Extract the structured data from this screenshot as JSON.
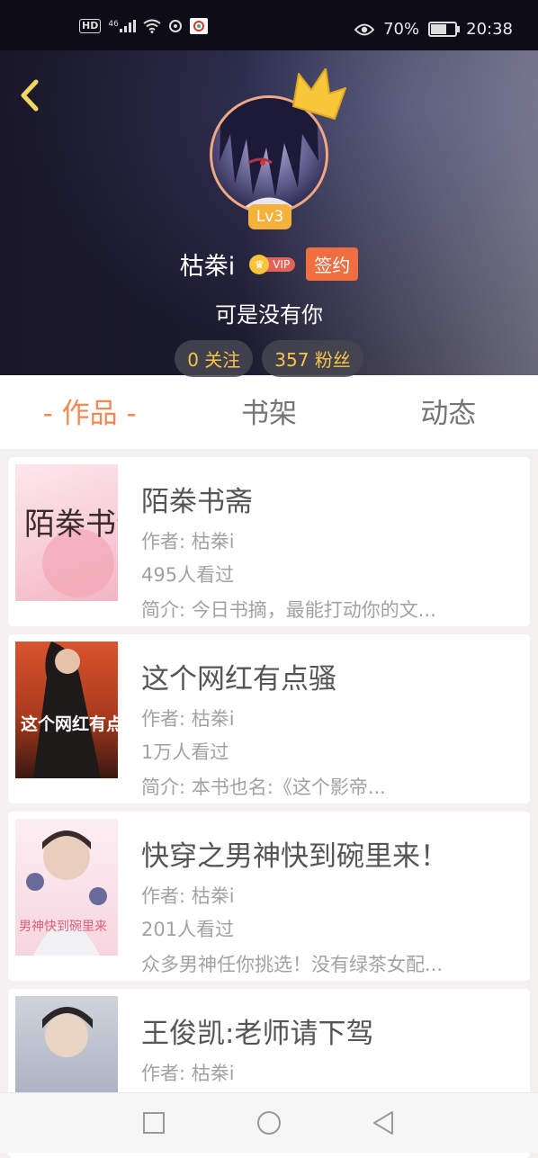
{
  "status_bar": {
    "hd": "HD",
    "network": "46",
    "battery_percent": "70%",
    "battery_level": 0.7,
    "time": "20:38"
  },
  "profile": {
    "level": "Lv3",
    "name": "枯桊i",
    "vip": "VIP",
    "signed": "签约",
    "bio": "可是没有你",
    "following": "0 关注",
    "followers": "357 粉丝"
  },
  "tabs": [
    "- 作品 -",
    "书架",
    "动态"
  ],
  "books": [
    {
      "title": "陌桊书斋",
      "author": "作者: 枯桊i",
      "views": "495人看过",
      "intro": "简介: 今日书摘，最能打动你的文...",
      "cover_text": "陌桊书斋"
    },
    {
      "title": "这个网红有点骚",
      "author": "作者: 枯桊i",
      "views": "1万人看过",
      "intro": "简介: 本书也名:《这个影帝...",
      "cover_text": "这个网红有点骚"
    },
    {
      "title": "快穿之男神快到碗里来！",
      "author": "作者: 枯桊i",
      "views": "201人看过",
      "intro": "众多男神任你挑选！没有绿茶女配...",
      "cover_text": "男神快到碗里来"
    },
    {
      "title": "王俊凯:老师请下驾",
      "author": "作者: 枯桊i",
      "views": "",
      "intro": "",
      "cover_text": ""
    }
  ],
  "colors": {
    "accent": "#ef8a55",
    "level_badge": "#f4b23c",
    "signed_badge": "#ef6f40",
    "stat_text": "#f7c44a"
  },
  "icons": [
    "back-icon",
    "crown-icon",
    "square-nav-icon",
    "circle-nav-icon",
    "triangle-nav-icon"
  ]
}
